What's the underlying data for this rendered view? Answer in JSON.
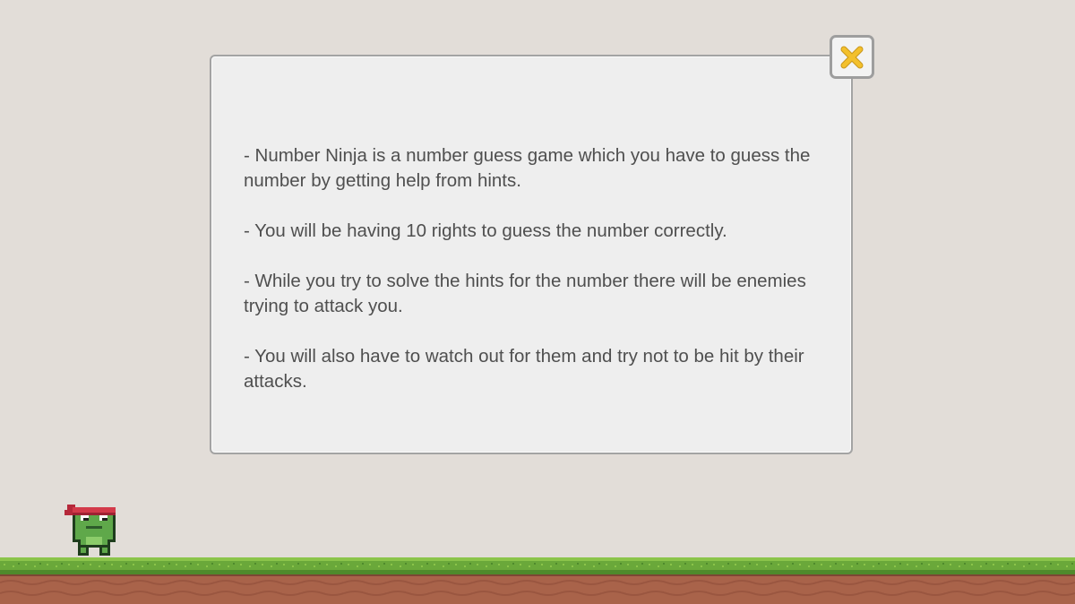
{
  "instructions": [
    "- Number Ninja is a number guess game which you have to guess the number by getting help from hints.",
    "- You will be having 10 rights to guess the number correctly.",
    "- While you try to solve the hints for the number there will be enemies trying to attack you.",
    "- You will also have to watch out for them and try not to be hit by their attacks."
  ],
  "close_button": {
    "icon": "close-icon"
  },
  "colors": {
    "background": "#e2ddd8",
    "dialog": "#eeeeee",
    "dialog_border": "#a3a3a3",
    "text": "#4f4f4f",
    "close_icon": "#f3c02c",
    "grass": "#6aa83a",
    "dirt": "#a9634a"
  },
  "characters": {
    "player": "ninja-frog"
  }
}
